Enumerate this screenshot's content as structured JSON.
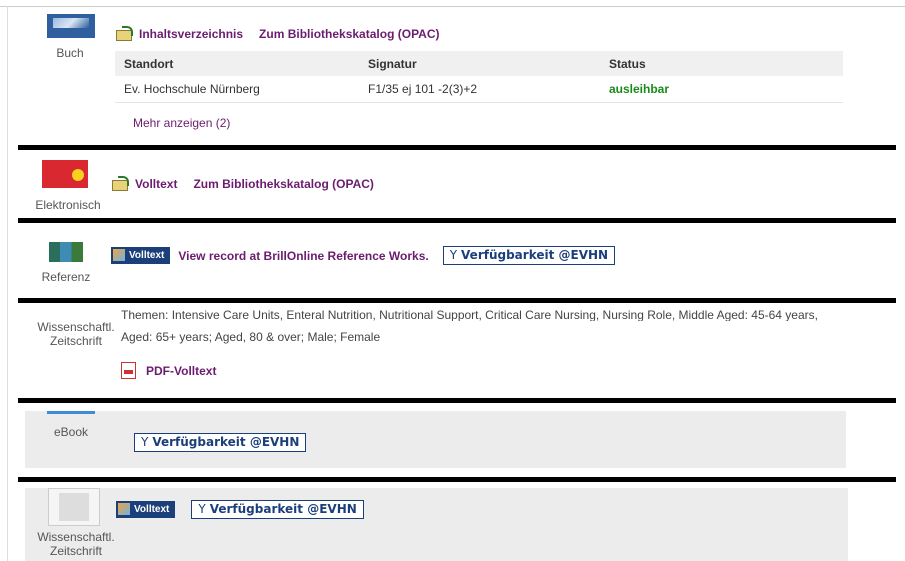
{
  "rec1": {
    "type": "Buch",
    "toc_link": "Inhaltsverzeichnis",
    "opac_link": "Zum Bibliothekskatalog (OPAC)",
    "columns": [
      "Standort",
      "Signatur",
      "Status"
    ],
    "rows": [
      [
        "Ev. Hochschule Nürnberg",
        "F1/35 ej 101 -2(3)+2",
        "ausleihbar"
      ]
    ],
    "more": "Mehr anzeigen (2)"
  },
  "rec2": {
    "type": "Elektronisch",
    "fulltext_link": "Volltext",
    "opac_link": "Zum Bibliothekskatalog (OPAC)"
  },
  "rec3": {
    "type": "Referenz",
    "badge": "Volltext",
    "view_link": "View record at BrillOnline Reference Works.",
    "avail": "Verfügbarkeit @EVHN"
  },
  "rec4": {
    "type": "Wissenschaftl. Zeitschrift",
    "subjects_line1": "Themen: Intensive Care Units, Enteral Nutrition, Nutritional Support, Critical Care Nursing, Nursing Role, Middle Aged: 45-64 years,",
    "subjects_line2": "Aged: 65+ years; Aged, 80 & over; Male; Female",
    "pdf_link": "PDF-Volltext"
  },
  "rec5": {
    "type": "eBook",
    "avail": "Verfügbarkeit @EVHN"
  },
  "rec6": {
    "type": "Wissenschaftl. Zeitschrift",
    "badge": "Volltext",
    "avail": "Verfügbarkeit @EVHN"
  },
  "colors": {
    "link": "#6b1c6e",
    "status_ok": "#1a8b1a",
    "badge": "#1b3f7a"
  }
}
